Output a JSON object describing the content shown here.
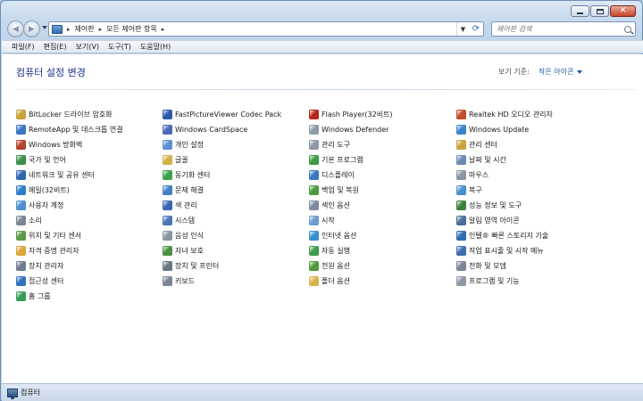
{
  "window": {
    "buttons": {
      "minimize": "minimize",
      "maximize": "maximize",
      "close": "✕"
    }
  },
  "address": {
    "crumbs": [
      "제어판",
      "모든 제어판 항목"
    ],
    "search_placeholder": "제어판 검색"
  },
  "menu": [
    "파일(F)",
    "편집(E)",
    "보기(V)",
    "도구(T)",
    "도움말(H)"
  ],
  "header": {
    "title": "컴퓨터 설정 변경",
    "view_by_label": "보기 기준:",
    "view_by_value": "작은 아이콘"
  },
  "columns": [
    [
      {
        "label": "BitLocker 드라이브 암호화",
        "icon": "bitlocker-icon",
        "color": "#c9a23a"
      },
      {
        "label": "RemoteApp 및 데스크톱 연결",
        "icon": "remoteapp-icon",
        "color": "#3a76c4"
      },
      {
        "label": "Windows 방화벽",
        "icon": "firewall-icon",
        "color": "#b3452e"
      },
      {
        "label": "국가 및 언어",
        "icon": "globe-clock-icon",
        "color": "#3d8f4a"
      },
      {
        "label": "네트워크 및 공유 센터",
        "icon": "network-icon",
        "color": "#2e66b0"
      },
      {
        "label": "메일(32비트)",
        "icon": "mail-icon",
        "color": "#2f7fc8"
      },
      {
        "label": "사용자 계정",
        "icon": "user-accounts-icon",
        "color": "#4f8ec9"
      },
      {
        "label": "소리",
        "icon": "speaker-icon",
        "color": "#7b8796"
      },
      {
        "label": "위치 및 기타 센서",
        "icon": "sensor-icon",
        "color": "#5d9a46"
      },
      {
        "label": "자격 증명 관리자",
        "icon": "credential-icon",
        "color": "#d9a53c"
      },
      {
        "label": "장치 관리자",
        "icon": "device-manager-icon",
        "color": "#6b7c93"
      },
      {
        "label": "접근성 센터",
        "icon": "accessibility-icon",
        "color": "#2e72c0"
      },
      {
        "label": "홈 그룹",
        "icon": "homegroup-icon",
        "color": "#3a9a5a"
      }
    ],
    [
      {
        "label": "FastPictureViewer Codec Pack",
        "icon": "fastpicture-icon",
        "color": "#2c5aa6"
      },
      {
        "label": "Windows CardSpace",
        "icon": "cardspace-icon",
        "color": "#4a69b8"
      },
      {
        "label": "개인 설정",
        "icon": "personalization-icon",
        "color": "#5a8fd0"
      },
      {
        "label": "글꼴",
        "icon": "fonts-icon",
        "color": "#d1b14a"
      },
      {
        "label": "동기화 센터",
        "icon": "sync-center-icon",
        "color": "#3ca24a"
      },
      {
        "label": "문제 해결",
        "icon": "troubleshooting-icon",
        "color": "#3f7fc4"
      },
      {
        "label": "색 관리",
        "icon": "color-management-icon",
        "color": "#3b67b0"
      },
      {
        "label": "시스템",
        "icon": "system-icon",
        "color": "#4a78b5"
      },
      {
        "label": "음성 인식",
        "icon": "microphone-icon",
        "color": "#8a95a3"
      },
      {
        "label": "자녀 보호",
        "icon": "parental-controls-icon",
        "color": "#4a8f3f"
      },
      {
        "label": "장치 및 프린터",
        "icon": "printer-icon",
        "color": "#6a7585"
      },
      {
        "label": "키보드",
        "icon": "keyboard-icon",
        "color": "#7a8494"
      }
    ],
    [
      {
        "label": "Flash Player(32비트)",
        "icon": "flash-icon",
        "color": "#b8261b"
      },
      {
        "label": "Windows Defender",
        "icon": "defender-icon",
        "color": "#8f9aa8"
      },
      {
        "label": "관리 도구",
        "icon": "admin-tools-icon",
        "color": "#8e97a5"
      },
      {
        "label": "기본 프로그램",
        "icon": "default-programs-icon",
        "color": "#3f9a46"
      },
      {
        "label": "디스플레이",
        "icon": "display-icon",
        "color": "#3a78c2"
      },
      {
        "label": "백업 및 복원",
        "icon": "backup-icon",
        "color": "#4b9a3c"
      },
      {
        "label": "색인 옵션",
        "icon": "indexing-icon",
        "color": "#7d8aa0"
      },
      {
        "label": "시작",
        "icon": "getting-started-icon",
        "color": "#6b9bd1"
      },
      {
        "label": "인터넷 옵션",
        "icon": "internet-options-icon",
        "color": "#3a8fcf"
      },
      {
        "label": "자동 실행",
        "icon": "autoplay-icon",
        "color": "#3d9a4d"
      },
      {
        "label": "전원 옵션",
        "icon": "power-icon",
        "color": "#4f9a3a"
      },
      {
        "label": "폴더 옵션",
        "icon": "folder-options-icon",
        "color": "#d8b24a"
      }
    ],
    [
      {
        "label": "Realtek HD 오디오 관리자",
        "icon": "realtek-icon",
        "color": "#c24a2e"
      },
      {
        "label": "Windows Update",
        "icon": "windows-update-icon",
        "color": "#3b84cc"
      },
      {
        "label": "관리 센터",
        "icon": "action-center-icon",
        "color": "#c8a33a"
      },
      {
        "label": "날짜 및 시간",
        "icon": "date-time-icon",
        "color": "#6c8bb3"
      },
      {
        "label": "마우스",
        "icon": "mouse-icon",
        "color": "#8a94a2"
      },
      {
        "label": "복구",
        "icon": "recovery-icon",
        "color": "#4a8fcc"
      },
      {
        "label": "성능 정보 및 도구",
        "icon": "performance-icon",
        "color": "#3d7f3d"
      },
      {
        "label": "알림 영역 아이콘",
        "icon": "notification-area-icon",
        "color": "#4a6d98"
      },
      {
        "label": "인텔® 빠른 스토리지 기술",
        "icon": "intel-storage-icon",
        "color": "#2e6bb3"
      },
      {
        "label": "작업 표시줄 및 시작 메뉴",
        "icon": "taskbar-icon",
        "color": "#3d6fb0"
      },
      {
        "label": "전화 및 모뎀",
        "icon": "phone-modem-icon",
        "color": "#7a8596"
      },
      {
        "label": "프로그램 및 기능",
        "icon": "programs-features-icon",
        "color": "#8c96a4"
      }
    ]
  ],
  "status": {
    "label": "컴퓨터"
  }
}
